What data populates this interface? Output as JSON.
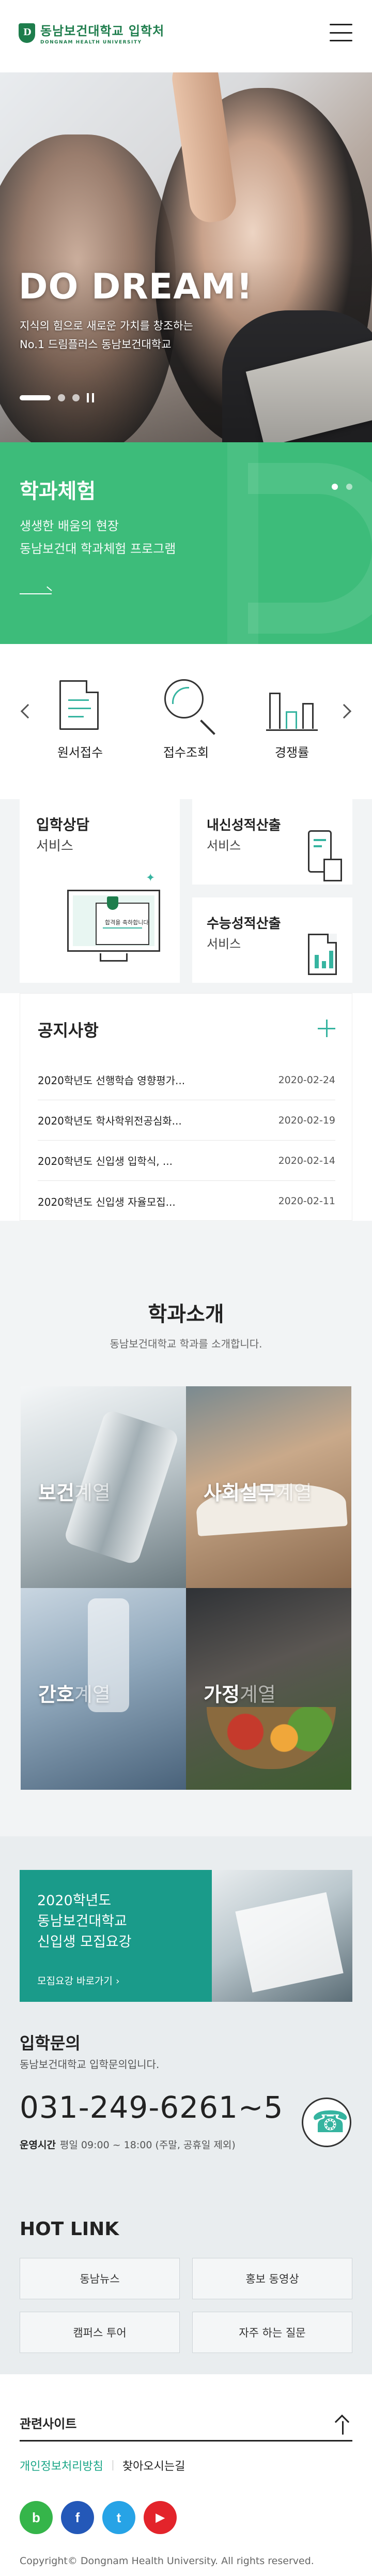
{
  "header": {
    "logo_ko": "동남보건대학교 입학처",
    "logo_en": "DONGNAM HEALTH UNIVERSITY"
  },
  "hero": {
    "title": "DO DREAM!",
    "sub_line1": "지식의 힘으로 새로운 가치를 창조하는",
    "sub_line2": "No.1 드림플러스 동남보건대학교"
  },
  "program": {
    "title": "학과체험",
    "line1": "생생한 배움의 현장",
    "line2": "동남보건대 학과체험 프로그램"
  },
  "quick": {
    "items": [
      {
        "label": "원서접수",
        "icon": "document-icon"
      },
      {
        "label": "접수조회",
        "icon": "magnifier-icon"
      },
      {
        "label": "경쟁률",
        "icon": "bar-chart-icon"
      }
    ]
  },
  "services": {
    "consult_title": "입학상담",
    "consult_sub": "서비스",
    "letter_text": "합격을 축하합니다",
    "grade_title": "내신성적산출",
    "grade_sub": "서비스",
    "csat_title": "수능성적산출",
    "csat_sub": "서비스"
  },
  "notice": {
    "title": "공지사항",
    "rows": [
      {
        "title": "2020학년도 선행학습 영향평가...",
        "date": "2020-02-24"
      },
      {
        "title": "2020학년도 학사학위전공심화...",
        "date": "2020-02-19"
      },
      {
        "title": "2020학년도 신입생 입학식, ...",
        "date": "2020-02-14"
      },
      {
        "title": "2020학년도 신입생 자율모집...",
        "date": "2020-02-11"
      }
    ]
  },
  "dept": {
    "title": "학과소개",
    "sub": "동남보건대학교 학과를 소개합니다.",
    "tiles": [
      {
        "name": "보건",
        "suffix": "계열"
      },
      {
        "name": "사회실무",
        "suffix": "계열"
      },
      {
        "name": "간호",
        "suffix": "계열"
      },
      {
        "name": "가정",
        "suffix": "계열"
      }
    ]
  },
  "recruit": {
    "line1": "2020학년도",
    "line2": "동남보건대학교",
    "line3": "신입생 모집요강",
    "link": "모집요강 바로가기"
  },
  "inquiry": {
    "title": "입학문의",
    "sub": "동남보건대학교 입학문의입니다.",
    "phone": "031-249-6261~5",
    "hours_label": "운영시간",
    "hours_value": "평일 09:00 ~ 18:00 (주말, 공휴일 제외)"
  },
  "hotlink": {
    "title": "HOT LINK",
    "buttons": [
      "동남뉴스",
      "홍보 동영상",
      "캠퍼스 투어",
      "자주 하는 질문"
    ]
  },
  "footer": {
    "related": "관련사이트",
    "privacy": "개인정보처리방침",
    "directions": "찾아오시는길",
    "socials": [
      {
        "name": "blog",
        "glyph": "b",
        "color": "#35b54a"
      },
      {
        "name": "facebook",
        "glyph": "f",
        "color": "#2458b8"
      },
      {
        "name": "twitter",
        "glyph": "t",
        "color": "#27a3e6"
      },
      {
        "name": "youtube",
        "glyph": "▶",
        "color": "#e3242b"
      }
    ],
    "copyright": "Copyright© Dongnam Health University. All rights reserved."
  },
  "colors": {
    "brand_green": "#1e7d4c",
    "banner_green": "#3dbc7a",
    "teal": "#1a9b8a",
    "accent": "#36b4a0"
  }
}
